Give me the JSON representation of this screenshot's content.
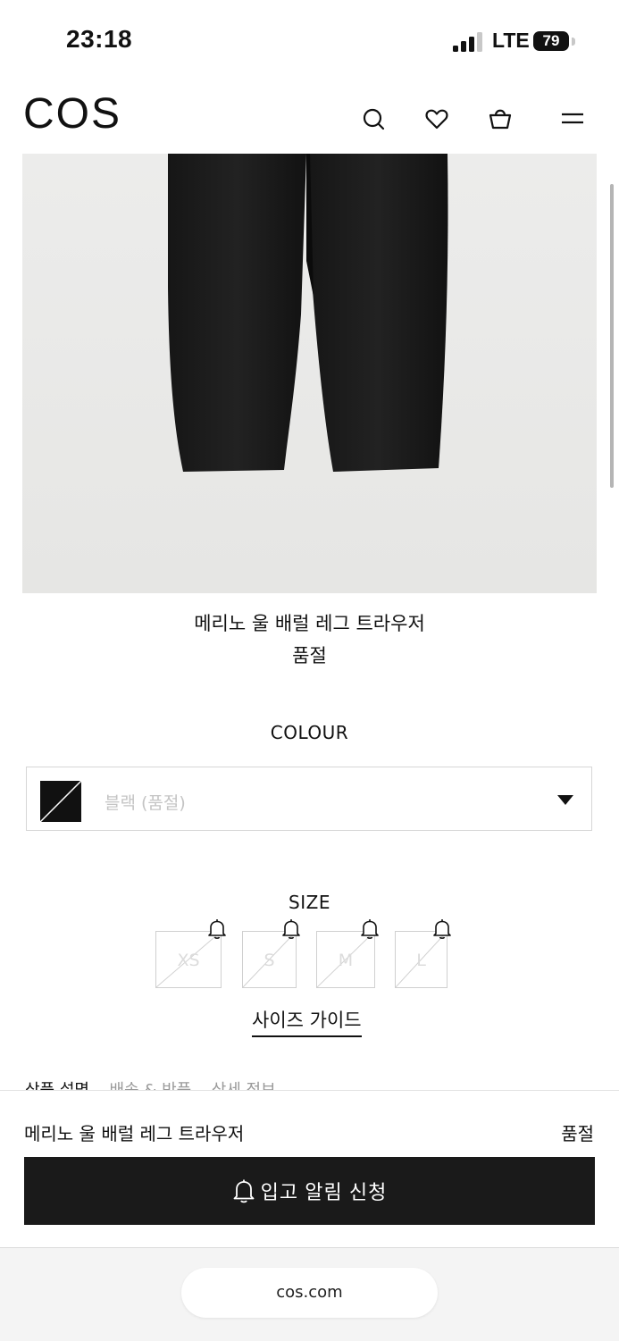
{
  "status_bar": {
    "time": "23:18",
    "network": "LTE",
    "battery": "79"
  },
  "header": {
    "logo": "COS",
    "icons": [
      "search-icon",
      "heart-icon",
      "bag-icon",
      "menu-icon"
    ]
  },
  "product": {
    "name": "메리노 울 배럴 레그 트라우저",
    "availability": "품절"
  },
  "colour": {
    "label": "COLOUR",
    "selected": "블랙 (품절)",
    "swatch_color": "#111111"
  },
  "size": {
    "label": "SIZE",
    "options": [
      "XS",
      "S",
      "M",
      "L"
    ],
    "guide_link": "사이즈 가이드"
  },
  "info_tabs": {
    "items": [
      "상품 설명",
      "배송 & 반품",
      "상세 정보"
    ]
  },
  "sticky_bar": {
    "name": "메리노 울 배럴 레그 트라우저",
    "status": "품절",
    "button_label": "입고 알림 신청"
  },
  "browser": {
    "url": "cos.com"
  }
}
